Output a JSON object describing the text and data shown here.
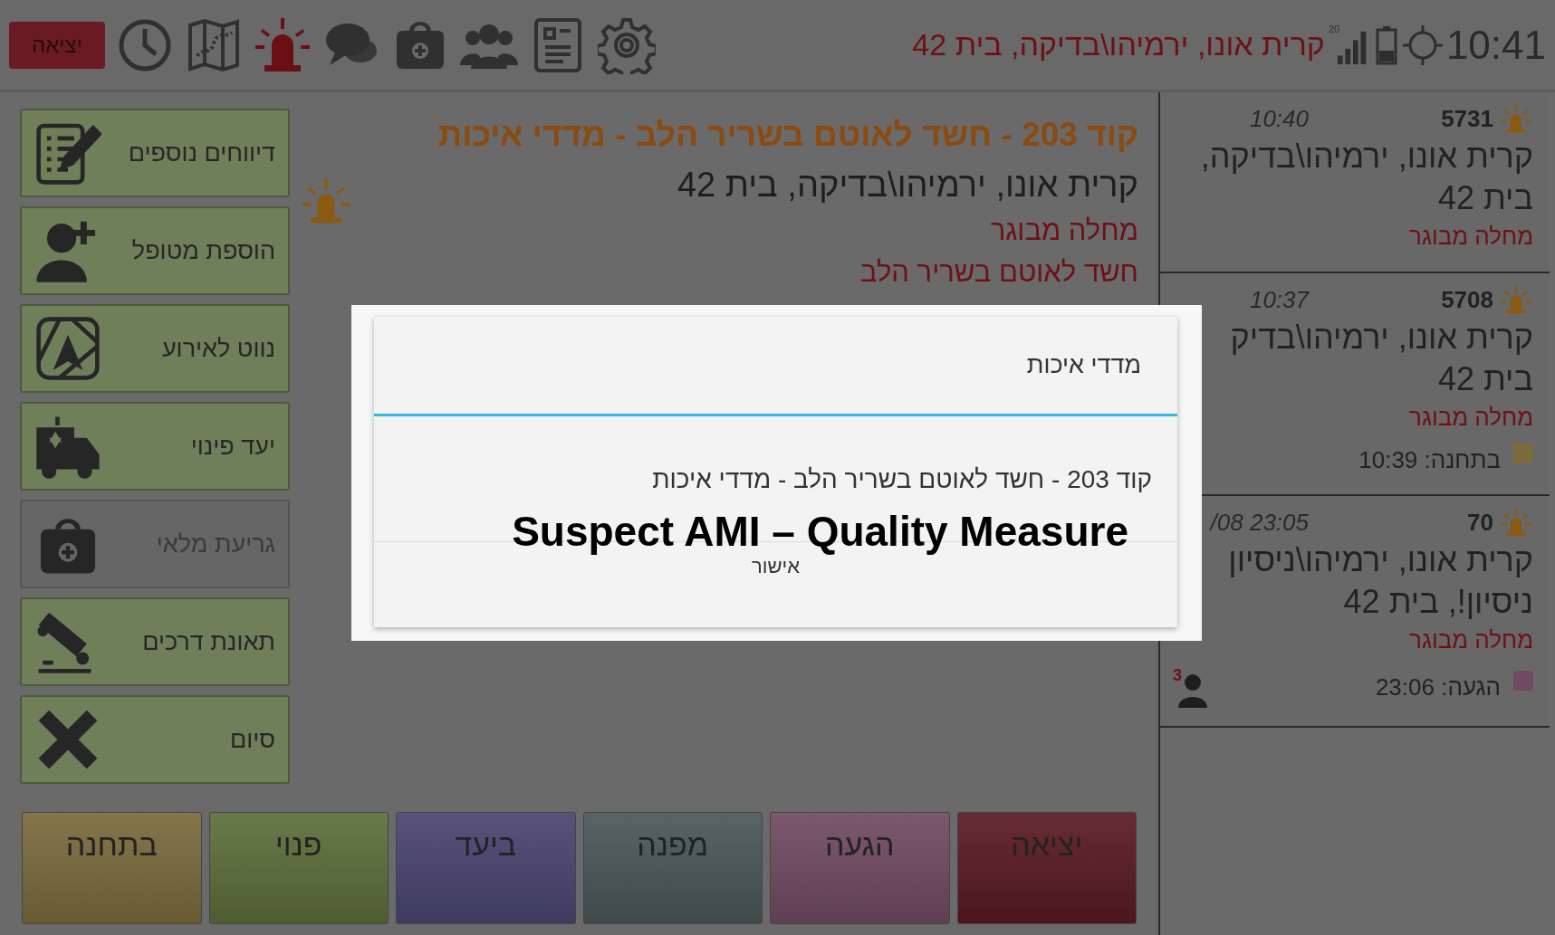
{
  "top_bar": {
    "exit_button": "יציאה",
    "address": "קרית אונו, ירמיהו\\בדיקה,  בית 42",
    "signal_label": "20",
    "time": "10:41",
    "tools": [
      {
        "kind": "clock",
        "active": false
      },
      {
        "kind": "map",
        "active": false
      },
      {
        "kind": "siren",
        "active": true
      },
      {
        "kind": "chat",
        "active": false
      },
      {
        "kind": "kit",
        "active": false
      },
      {
        "kind": "team",
        "active": false
      },
      {
        "kind": "card",
        "active": false
      },
      {
        "kind": "gear",
        "active": false
      }
    ]
  },
  "event": {
    "title": "קוד 203 - חשד לאוטם בשריר הלב - מדדי איכות",
    "address": "קרית אונו, ירמיהו\\בדיקה,  בית 42",
    "category": "מחלה מבוגר",
    "description": "חשד לאוטם בשריר הלב"
  },
  "side_actions": [
    {
      "label": "דיווחים נוספים",
      "kind": "report",
      "disabled": false
    },
    {
      "label": "הוספת מטופל",
      "kind": "add-patient",
      "disabled": false
    },
    {
      "label": "נווט לאירוע",
      "kind": "navigate",
      "disabled": false
    },
    {
      "label": "יעד פינוי",
      "kind": "ambulance",
      "disabled": false
    },
    {
      "label": "גריעת מלאי",
      "kind": "kit",
      "disabled": true
    },
    {
      "label": "תאונת דרכים",
      "kind": "accident",
      "disabled": false
    },
    {
      "label": "סיום",
      "kind": "finish",
      "disabled": false
    }
  ],
  "status_buttons": [
    {
      "label": "יציאה",
      "color": "#5a1a22"
    },
    {
      "label": "הגעה",
      "color": "#704a62"
    },
    {
      "label": "מפנה",
      "color": "#4a5757"
    },
    {
      "label": "ביעד",
      "color": "#4a4470"
    },
    {
      "label": "פנוי",
      "color": "#5b6e3a"
    },
    {
      "label": "בתחנה",
      "color": "#7a6a3c"
    }
  ],
  "incidents": [
    {
      "number": "5731",
      "time": "10:40",
      "address_lines": [
        "קרית אונו, ירמיהו\\בדיקה,",
        "בית 42"
      ],
      "category": "מחלה מבוגר"
    },
    {
      "number": "5708",
      "time": "10:37",
      "address_lines": [
        "קרית אונו, ירמיהו\\בדיק",
        "בית 42"
      ],
      "category": "מחלה מבוגר",
      "status": {
        "label": "בתחנה: 10:39",
        "color": "#7a6a3c"
      }
    },
    {
      "number": "70",
      "time": "/08 23:05",
      "address_lines": [
        "קרית אונו, ירמיהו\\ניסיון",
        "ניסיון!,  בית 42"
      ],
      "category": "מחלה מבוגר",
      "status": {
        "label": "הגעה: 23:06",
        "color": "#704a62"
      },
      "patients": "3"
    }
  ],
  "dialog": {
    "title": "מדדי איכות",
    "message": "קוד 203 - חשד לאוטם בשריר הלב - מדדי איכות",
    "caption": "Suspect AMI – Quality Measure",
    "confirm": "אישור"
  }
}
